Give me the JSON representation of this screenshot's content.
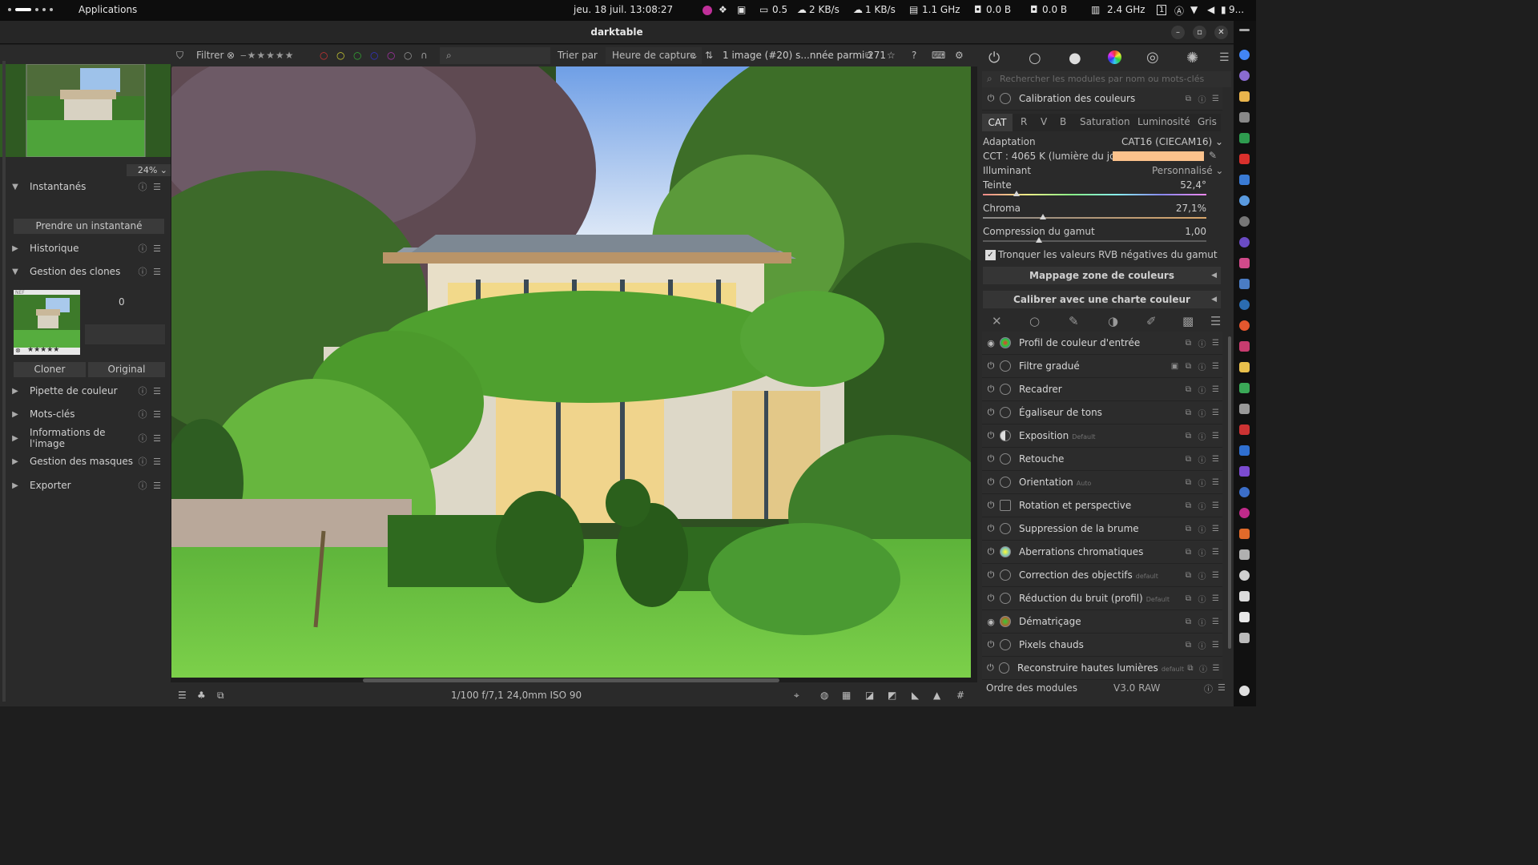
{
  "system": {
    "activities": "Applications",
    "datetime": "jeu. 18 juil.  13:08:27",
    "load": "0.5",
    "net_down": "2 KB/s",
    "net_up": "1 KB/s",
    "cpu_freq": "1.1 GHz",
    "disk_read": "0.0 B",
    "disk_write": "0.0 B",
    "gpu_freq": "2.4 GHz",
    "keyboard": "1",
    "battery": "9..."
  },
  "window": {
    "title": "darktable",
    "minimize": "–",
    "maximize": "▫",
    "close": "✕"
  },
  "filterbar": {
    "filter_label": "Filtrer",
    "sort_label": "Trier par",
    "sort_value": "Heure de capture",
    "count_text": "1 image (#20) s...nnée parmi 271",
    "help": "?"
  },
  "left_panel": {
    "zoom": "24%",
    "modules": [
      {
        "label": "Instantanés",
        "expanded": true
      },
      {
        "label": "Historique",
        "expanded": false
      },
      {
        "label": "Gestion des clones",
        "expanded": true
      },
      {
        "label": "Pipette de couleur",
        "expanded": false
      },
      {
        "label": "Mots-clés",
        "expanded": false
      },
      {
        "label": "Informations de l'image",
        "expanded": false
      },
      {
        "label": "Gestion des masques",
        "expanded": false
      },
      {
        "label": "Exporter",
        "expanded": false
      }
    ],
    "snapshot_button": "Prendre un instantané",
    "clone_count": "0",
    "clone_thumb_tag": "NEF",
    "clone_thumb_stars": "★★★★★",
    "clone_button": "Cloner",
    "original_button": "Original"
  },
  "bottom_bar": {
    "exif": "1/100 f/7,1 24,0mm ISO 90"
  },
  "right_panel": {
    "search_placeholder": "Rechercher les modules par nom ou mots-clés",
    "color_calibration": {
      "title": "Calibration des couleurs",
      "tabs": [
        "CAT",
        "R",
        "V",
        "B",
        "Saturation",
        "Luminosité",
        "Gris"
      ],
      "active_tab": "CAT",
      "adaptation_label": "Adaptation",
      "adaptation_value": "CAT16 (CIECAM16)",
      "cct_label": "CCT : 4065 K (lumière du jour)",
      "cct_swatch_color": "#fbc28c",
      "illuminant_label": "Illuminant",
      "illuminant_value": "Personnalisé",
      "sliders": [
        {
          "label": "Teinte",
          "value": "52,4°",
          "fraction": 0.15
        },
        {
          "label": "Chroma",
          "value": "27,1%",
          "fraction": 0.27
        },
        {
          "label": "Compression du gamut",
          "value": "1,00",
          "fraction": 0.25
        }
      ],
      "clip_label": "Tronquer les valeurs RVB négatives du gamut",
      "clip_checked": true,
      "gamut_mapping_button": "Mappage zone de couleurs",
      "calibrate_button": "Calibrer avec une charte couleur"
    },
    "modules": [
      {
        "name": "Profil de couleur d'entrée",
        "tag": "",
        "enabled": true
      },
      {
        "name": "Filtre gradué",
        "tag": "",
        "enabled": true
      },
      {
        "name": "Recadrer",
        "tag": "",
        "enabled": true
      },
      {
        "name": "Égaliseur de tons",
        "tag": "",
        "enabled": true
      },
      {
        "name": "Exposition",
        "tag": "Default",
        "enabled": true
      },
      {
        "name": "Retouche",
        "tag": "",
        "enabled": true
      },
      {
        "name": "Orientation",
        "tag": "Auto",
        "enabled": true
      },
      {
        "name": "Rotation et perspective",
        "tag": "",
        "enabled": true
      },
      {
        "name": "Suppression de la brume",
        "tag": "",
        "enabled": true
      },
      {
        "name": "Aberrations chromatiques",
        "tag": "",
        "enabled": true
      },
      {
        "name": "Correction des objectifs",
        "tag": "default",
        "enabled": true
      },
      {
        "name": "Réduction du bruit (profil)",
        "tag": "Default",
        "enabled": true
      },
      {
        "name": "Dématriçage",
        "tag": "",
        "enabled": true
      },
      {
        "name": "Pixels chauds",
        "tag": "",
        "enabled": true
      },
      {
        "name": "Reconstruire hautes lumières",
        "tag": "default",
        "enabled": true
      }
    ],
    "module_order_label": "Ordre des modules",
    "module_order_value": "V3.0 RAW"
  }
}
